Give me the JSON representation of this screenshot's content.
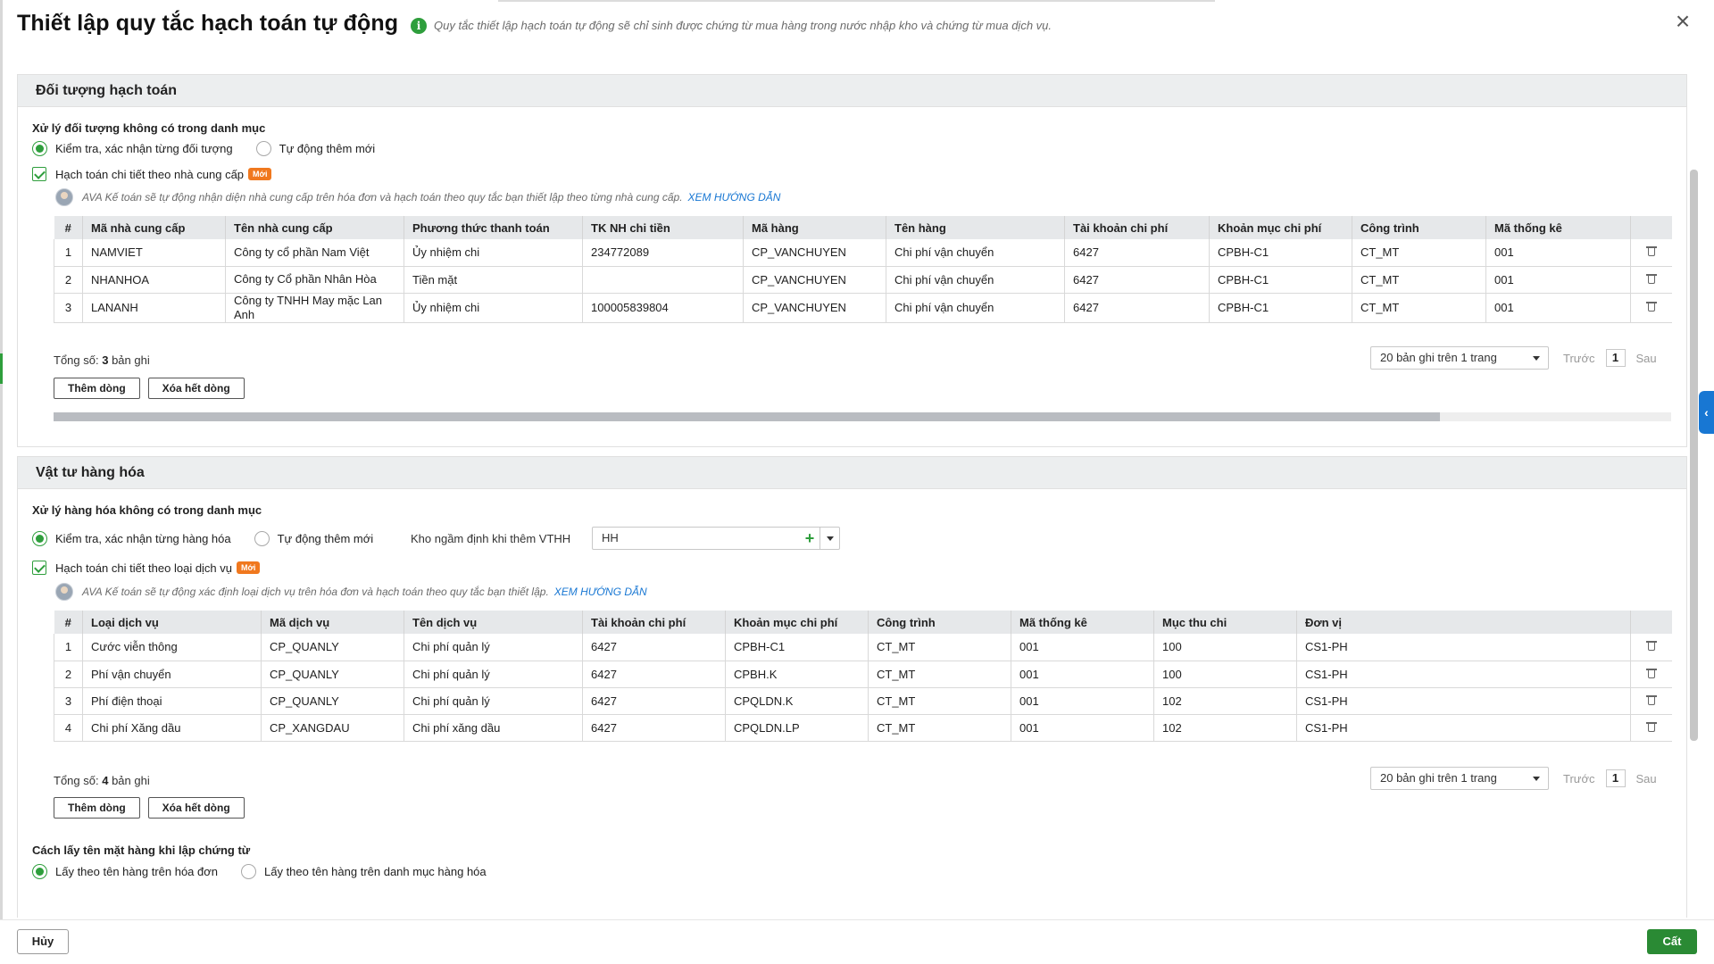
{
  "dialog": {
    "title": "Thiết lập quy tắc hạch toán tự động",
    "info_text": "Quy tắc thiết lập hạch toán tự động sẽ chỉ sinh được chứng từ mua hàng trong nước nhập kho và chứng từ mua dịch vụ.",
    "close_icon": "close-icon"
  },
  "section1": {
    "title": "Đối tượng hạch toán",
    "subtitle": "Xử lý đối tượng không có trong danh mục",
    "radio_options": [
      "Kiểm tra, xác nhận từng đối tượng",
      "Tự động thêm mới"
    ],
    "selected_radio": 0,
    "checkbox_label": "Hạch toán chi tiết theo nhà cung cấp",
    "checkbox_checked": true,
    "badge": "Mới",
    "hint_text": "AVA Kế toán sẽ tự động nhận diện nhà cung cấp trên hóa đơn và hạch toán theo quy tắc bạn thiết lập theo từng nhà cung cấp.",
    "hint_link": "XEM HƯỚNG DẪN",
    "table": {
      "columns": [
        "#",
        "Mã nhà cung cấp",
        "Tên nhà cung cấp",
        "Phương thức thanh toán",
        "TK NH chi tiền",
        "Mã hàng",
        "Tên hàng",
        "Tài khoản chi phí",
        "Khoản mục chi phí",
        "Công trình",
        "Mã thống kê"
      ],
      "rows": [
        [
          "1",
          "NAMVIET",
          "Công ty cổ phần Nam Việt",
          "Ủy nhiệm chi",
          "234772089",
          "CP_VANCHUYEN",
          "Chi phí vận chuyển",
          "6427",
          "CPBH-C1",
          "CT_MT",
          "001"
        ],
        [
          "2",
          "NHANHOA",
          "Công ty Cổ phần Nhân Hòa",
          "Tiền mặt",
          "",
          "CP_VANCHUYEN",
          "Chi phí vận chuyển",
          "6427",
          "CPBH-C1",
          "CT_MT",
          "001"
        ],
        [
          "3",
          "LANANH",
          "Công ty TNHH May mặc Lan Anh",
          "Ủy nhiệm chi",
          "100005839804",
          "CP_VANCHUYEN",
          "Chi phí vận chuyển",
          "6427",
          "CPBH-C1",
          "CT_MT",
          "001"
        ]
      ]
    },
    "total_label": "Tổng số:",
    "total_count": "3",
    "total_suffix": "bản ghi",
    "pager": {
      "page_size": "20 bản ghi trên 1 trang",
      "prev": "Trước",
      "page": "1",
      "next": "Sau"
    },
    "add_row": "Thêm dòng",
    "clear_rows": "Xóa hết dòng",
    "scroll_fraction": 0.857
  },
  "section2": {
    "title": "Vật tư hàng hóa",
    "subtitle": "Xử lý hàng hóa không có trong danh mục",
    "radio_options": [
      "Kiểm tra, xác nhận từng hàng hóa",
      "Tự động thêm mới"
    ],
    "selected_radio": 0,
    "warehouse_label": "Kho ngầm định khi thêm VTHH",
    "warehouse_value": "HH",
    "checkbox_label": "Hạch toán chi tiết theo loại dịch vụ",
    "checkbox_checked": true,
    "badge": "Mới",
    "hint_text": "AVA Kế toán sẽ tự động xác định loại dịch vụ trên hóa đơn và hạch toán theo quy tắc bạn thiết lập.",
    "hint_link": "XEM HƯỚNG DẪN",
    "table": {
      "columns": [
        "#",
        "Loại dịch vụ",
        "Mã dịch vụ",
        "Tên dịch vụ",
        "Tài khoản chi phí",
        "Khoản mục chi phí",
        "Công trình",
        "Mã thống kê",
        "Mục thu chi",
        "Đơn vị"
      ],
      "rows": [
        [
          "1",
          "Cước viễn thông",
          "CP_QUANLY",
          "Chi phí quản lý",
          "6427",
          "CPBH-C1",
          "CT_MT",
          "001",
          "100",
          "CS1-PH"
        ],
        [
          "2",
          "Phí vận chuyển",
          "CP_QUANLY",
          "Chi phí quản lý",
          "6427",
          "CPBH.K",
          "CT_MT",
          "001",
          "100",
          "CS1-PH"
        ],
        [
          "3",
          "Phí điện thoại",
          "CP_QUANLY",
          "Chi phí quản lý",
          "6427",
          "CPQLDN.K",
          "CT_MT",
          "001",
          "102",
          "CS1-PH"
        ],
        [
          "4",
          "Chi phí Xăng dầu",
          "CP_XANGDAU",
          "Chi phí xăng dầu",
          "6427",
          "CPQLDN.LP",
          "CT_MT",
          "001",
          "102",
          "CS1-PH"
        ]
      ]
    },
    "total_label": "Tổng số:",
    "total_count": "4",
    "total_suffix": "bản ghi",
    "pager": {
      "page_size": "20 bản ghi trên 1 trang",
      "prev": "Trước",
      "page": "1",
      "next": "Sau"
    },
    "add_row": "Thêm dòng",
    "clear_rows": "Xóa hết dòng",
    "name_source_title": "Cách lấy tên mặt hàng khi lập chứng từ",
    "name_source_options": [
      "Lấy theo tên hàng trên hóa đơn",
      "Lấy theo tên hàng trên danh mục hàng hóa"
    ],
    "name_source_selected": 0
  },
  "footer": {
    "cancel": "Hủy",
    "save": "Cất"
  },
  "colors": {
    "accent": "#2e9e3c",
    "link": "#1877d3",
    "badge": "#f0781e",
    "save_button": "#2a8a34"
  }
}
